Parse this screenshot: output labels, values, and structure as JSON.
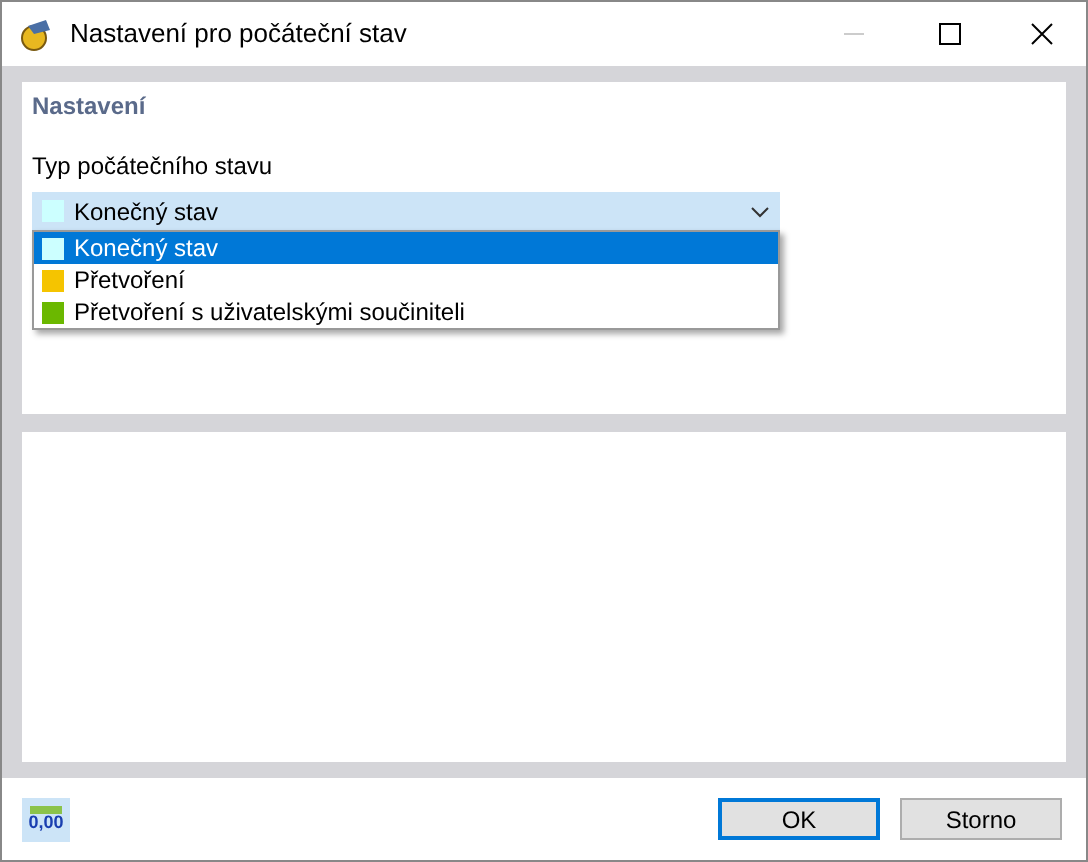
{
  "window": {
    "title": "Nastavení pro počáteční stav"
  },
  "settings": {
    "heading": "Nastavení",
    "field_label": "Typ počátečního stavu",
    "combo": {
      "value": "Konečný stav",
      "color": "#ccffff"
    },
    "options": [
      {
        "label": "Konečný stav",
        "color": "#ccffff",
        "selected": true
      },
      {
        "label": "Přetvoření",
        "color": "#f5c400",
        "selected": false
      },
      {
        "label": "Přetvoření s uživatelskými součiniteli",
        "color": "#6bb800",
        "selected": false
      }
    ]
  },
  "footer": {
    "precision_button": "0,00",
    "buttons": [
      {
        "label": "OK",
        "default": true
      },
      {
        "label": "Storno",
        "default": false
      }
    ]
  }
}
